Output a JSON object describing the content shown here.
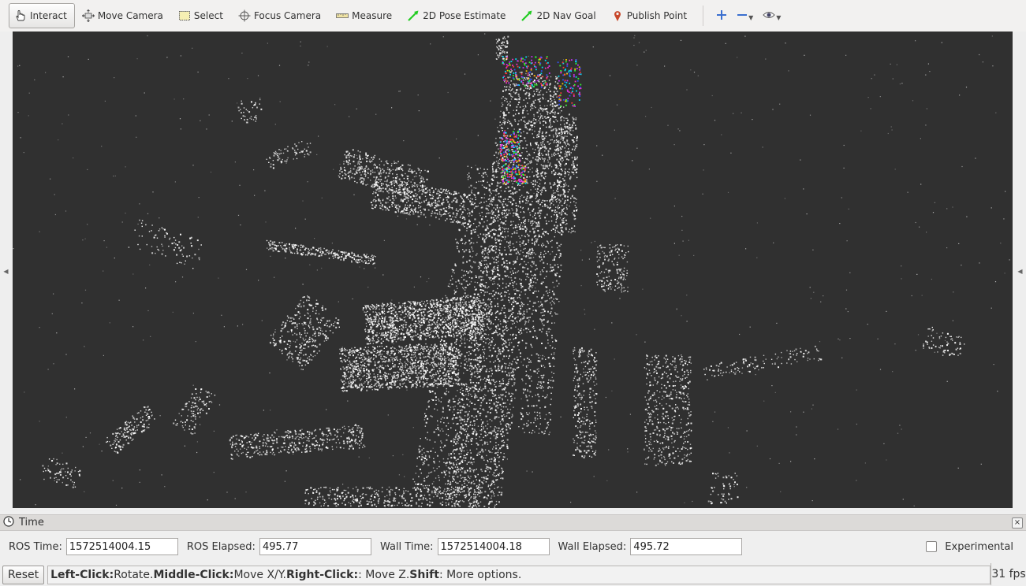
{
  "toolbar": {
    "tools": [
      {
        "label": "Interact",
        "icon": "hand-pointer-icon",
        "active": true
      },
      {
        "label": "Move Camera",
        "icon": "move-camera-icon"
      },
      {
        "label": "Select",
        "icon": "select-box-icon"
      },
      {
        "label": "Focus Camera",
        "icon": "crosshair-icon"
      },
      {
        "label": "Measure",
        "icon": "ruler-icon"
      },
      {
        "label": "2D Pose Estimate",
        "icon": "green-arrow-icon"
      },
      {
        "label": "2D Nav Goal",
        "icon": "green-arrow-icon"
      },
      {
        "label": "Publish Point",
        "icon": "map-pin-icon"
      }
    ],
    "extra_icons": [
      "plus-icon",
      "minus-icon",
      "eye-icon"
    ],
    "colors": {
      "plus": "#3a6fcf",
      "minus": "#3a6fcf",
      "arrow": "#22cc22",
      "pin": "#c8472a"
    }
  },
  "viewport": {
    "background": "#303030",
    "point_color": "#ffffff"
  },
  "time_panel": {
    "title": "Time",
    "ros_time_label": "ROS Time:",
    "ros_time_value": "1572514004.15",
    "ros_elapsed_label": "ROS Elapsed:",
    "ros_elapsed_value": "495.77",
    "wall_time_label": "Wall Time:",
    "wall_time_value": "1572514004.18",
    "wall_elapsed_label": "Wall Elapsed:",
    "wall_elapsed_value": "495.72",
    "experimental_label": "Experimental",
    "experimental_checked": false
  },
  "status_bar": {
    "reset_label": "Reset",
    "hint": [
      {
        "text": "Left-Click:",
        "bold": true
      },
      {
        "text": " Rotate. ",
        "bold": false
      },
      {
        "text": "Middle-Click:",
        "bold": true
      },
      {
        "text": " Move X/Y. ",
        "bold": false
      },
      {
        "text": "Right-Click:",
        "bold": true
      },
      {
        "text": ": Move Z. ",
        "bold": false
      },
      {
        "text": "Shift",
        "bold": true
      },
      {
        "text": ": More options.",
        "bold": false
      }
    ],
    "fps": "31 fps"
  }
}
